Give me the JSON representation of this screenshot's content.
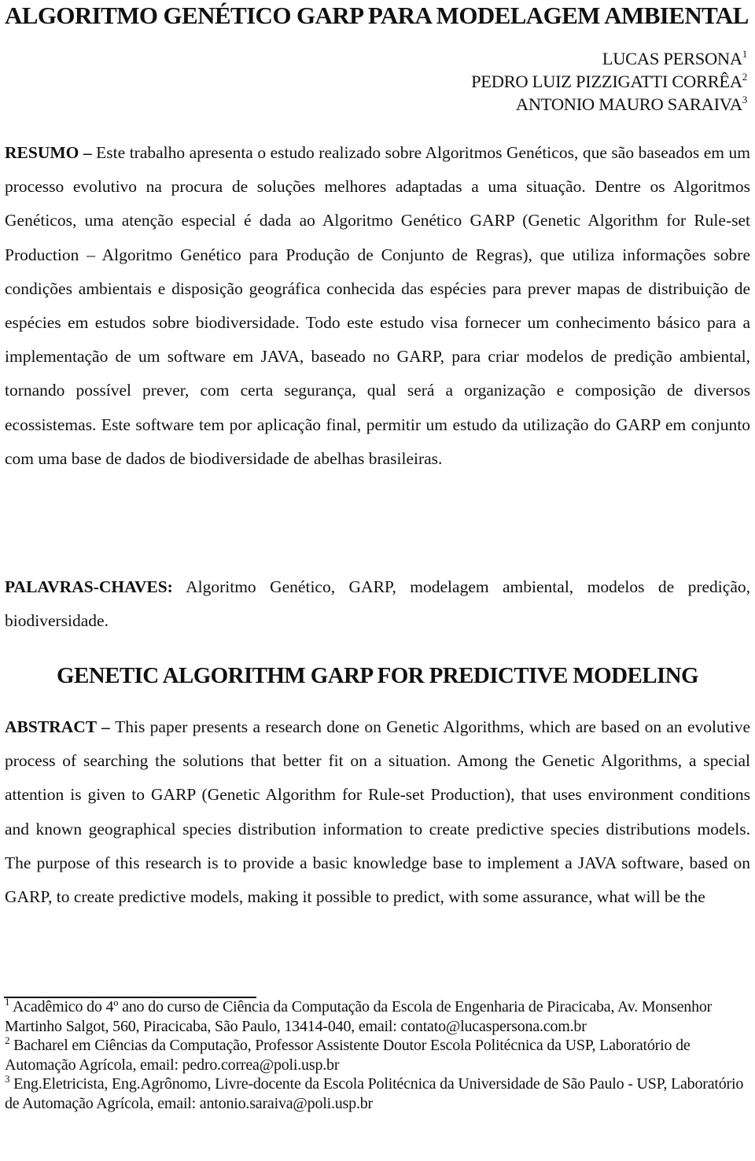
{
  "document": {
    "title": "ALGORITMO GENÉTICO GARP PARA MODELAGEM AMBIENTAL",
    "authors": [
      {
        "name": "LUCAS PERSONA",
        "mark": "1"
      },
      {
        "name": "PEDRO LUIZ PIZZIGATTI CORRÊA",
        "mark": "2"
      },
      {
        "name": "ANTONIO MAURO SARAIVA",
        "mark": "3"
      }
    ],
    "resumo": {
      "label": "RESUMO",
      "dash": " – ",
      "text": "Este trabalho apresenta o estudo realizado sobre Algoritmos Genéticos, que são baseados em um processo evolutivo na procura de soluções melhores adaptadas a uma situação. Dentre os Algoritmos Genéticos, uma atenção especial é dada ao Algoritmo Genético GARP (Genetic Algorithm for Rule-set Production – Algoritmo Genético para Produção de Conjunto de Regras), que utiliza informações sobre condições ambientais e disposição geográfica conhecida das espécies para prever mapas de distribuição de espécies em estudos sobre biodiversidade. Todo este estudo visa fornecer um conhecimento básico para a implementação de um software em JAVA, baseado no GARP, para criar modelos de predição ambiental, tornando possível prever, com certa segurança, qual será a organização e composição de diversos ecossistemas. Este software tem por aplicação final, permitir um estudo da utilização do GARP em conjunto com uma base de dados de biodiversidade de abelhas brasileiras."
    },
    "keywords": {
      "label": "PALAVRAS-CHAVES:",
      "text": " Algoritmo Genético, GARP, modelagem ambiental, modelos de predição, biodiversidade."
    },
    "english_title": "GENETIC ALGORITHM GARP FOR PREDICTIVE MODELING",
    "abstract": {
      "label": "ABSTRACT",
      "dash": " – ",
      "text": "This paper presents a research done on Genetic Algorithms, which are based on an evolutive process of searching the solutions that better fit on a situation. Among the Genetic Algorithms, a special attention is given to GARP (Genetic Algorithm for Rule-set Production), that uses environment conditions and known geographical species distribution information to create predictive species distributions models. The purpose of this research is to provide a basic knowledge base to implement a JAVA software, based on GARP, to create predictive models, making it possible to predict, with some assurance, what will be the"
    },
    "footnotes": [
      {
        "mark": "1",
        "text": " Acadêmico do 4º ano do curso de Ciência da Computação da Escola de Engenharia de Piracicaba, Av. Monsenhor Martinho Salgot, 560, Piracicaba, São Paulo, 13414-040, email: contato@lucaspersona.com.br"
      },
      {
        "mark": "2",
        "text": " Bacharel em Ciências da Computação, Professor Assistente Doutor Escola Politécnica da USP, Laboratório de Automação Agrícola, email: pedro.correa@poli.usp.br"
      },
      {
        "mark": "3",
        "text": " Eng.Eletricista, Eng.Agrônomo, Livre-docente da Escola Politécnica da Universidade de São Paulo - USP, Laboratório de Automação Agrícola, email: antonio.saraiva@poli.usp.br"
      }
    ]
  }
}
